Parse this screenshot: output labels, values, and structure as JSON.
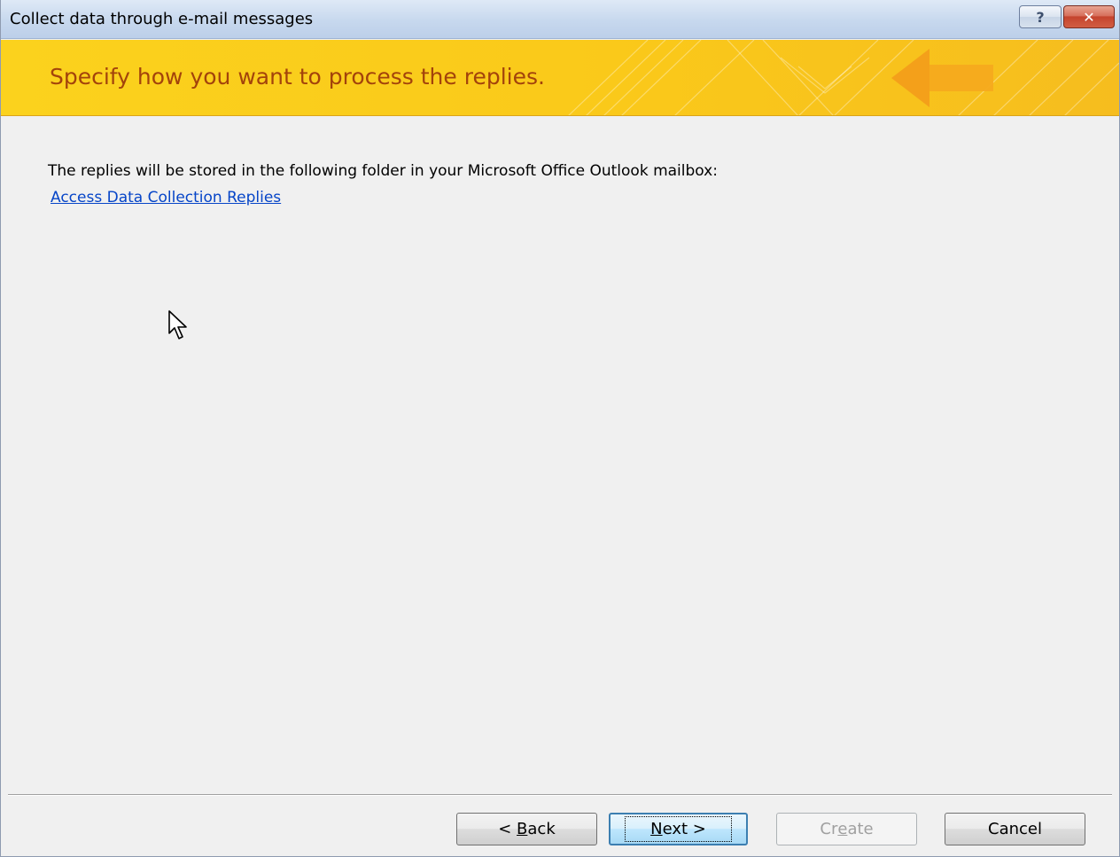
{
  "window": {
    "title": "Collect data through e-mail messages",
    "help_glyph": "?",
    "close_glyph": "✕"
  },
  "banner": {
    "heading": "Specify how you want to process the replies."
  },
  "content": {
    "description": "The replies will be stored in the following folder in your Microsoft Office Outlook mailbox:",
    "folder_link": "Access Data Collection Replies"
  },
  "buttons": {
    "back": {
      "prefix": "< ",
      "mnemonic": "B",
      "rest": "ack"
    },
    "next": {
      "prefix": "",
      "mnemonic": "N",
      "rest": "ext >"
    },
    "create": {
      "prefix": "Cr",
      "mnemonic": "e",
      "rest": "ate",
      "enabled": false
    },
    "cancel": {
      "label": "Cancel"
    }
  },
  "colors": {
    "banner_yellow": "#fbd21d",
    "heading_text": "#a3430b",
    "link": "#0645c8",
    "dialog_bg": "#f0f0f0"
  },
  "icons": [
    "help-icon",
    "close-icon",
    "banner-arrow-icon",
    "mouse-cursor-icon"
  ]
}
